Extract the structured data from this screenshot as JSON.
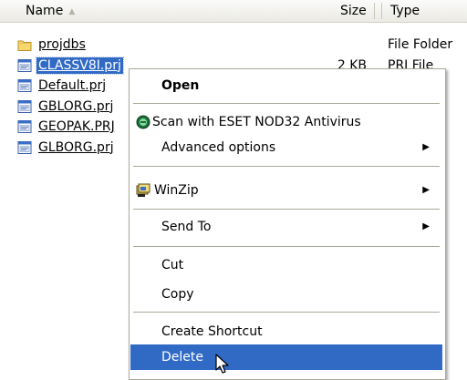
{
  "columns": {
    "name": "Name",
    "size": "Size",
    "type": "Type"
  },
  "files": [
    {
      "name": "projdbs",
      "size": "",
      "type": "File Folder",
      "icon": "folder-icon",
      "selected": false
    },
    {
      "name": "CLASSV8I.prj",
      "size": "2 KB",
      "type": "PRJ File",
      "icon": "prj-file-icon",
      "selected": true
    },
    {
      "name": "Default.prj",
      "size": "",
      "type": "",
      "icon": "prj-file-icon",
      "selected": false
    },
    {
      "name": "GBLORG.prj",
      "size": "",
      "type": "",
      "icon": "prj-file-icon",
      "selected": false
    },
    {
      "name": "GEOPAK.PRJ",
      "size": "",
      "type": "",
      "icon": "prj-file-icon",
      "selected": false
    },
    {
      "name": "GLBORG.prj",
      "size": "",
      "type": "",
      "icon": "prj-file-icon",
      "selected": false
    }
  ],
  "context_menu": {
    "open": "Open",
    "scan": "Scan with ESET NOD32 Antivirus",
    "advanced": "Advanced options",
    "winzip": "WinZip",
    "send_to": "Send To",
    "cut": "Cut",
    "copy": "Copy",
    "create_shortcut": "Create Shortcut",
    "delete": "Delete"
  },
  "colors": {
    "selection": "#316ac5",
    "menu_border": "#aca899",
    "header_bg": "#ebeae3"
  }
}
